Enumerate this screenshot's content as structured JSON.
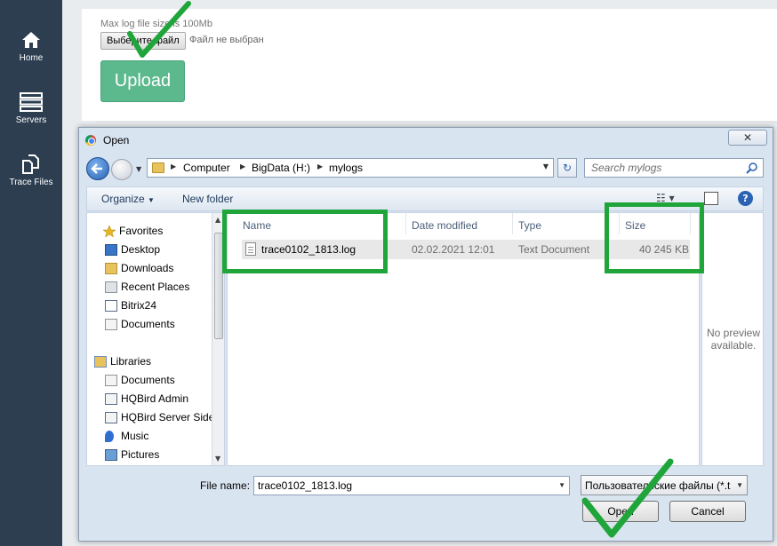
{
  "sidebar": {
    "items": [
      {
        "label": "Home",
        "icon": "home-icon"
      },
      {
        "label": "Servers",
        "icon": "servers-icon"
      },
      {
        "label": "Trace Files",
        "icon": "trace-files-icon"
      }
    ]
  },
  "upload": {
    "max_note": "Max log file size is 100Mb",
    "choose_file_label": "Выберите файл",
    "no_file_label": "Файл не выбран",
    "upload_label": "Upload"
  },
  "dialog": {
    "title": "Open",
    "close_label": "✕",
    "breadcrumb": [
      "Computer",
      "BigData (H:)",
      "mylogs"
    ],
    "search_placeholder": "Search mylogs",
    "toolbar": {
      "organize_label": "Organize",
      "new_folder_label": "New folder"
    },
    "nav": {
      "favorites_label": "Favorites",
      "favorites": [
        "Desktop",
        "Downloads",
        "Recent Places",
        "Bitrix24",
        "Documents"
      ],
      "libraries_label": "Libraries",
      "libraries": [
        "Documents",
        "HQBird Admin",
        "HQBird Server Side",
        "Music",
        "Pictures"
      ]
    },
    "columns": {
      "name": "Name",
      "date": "Date modified",
      "type": "Type",
      "size": "Size"
    },
    "files": [
      {
        "name": "trace0102_1813.log",
        "date": "02.02.2021 12:01",
        "type": "Text Document",
        "size": "40 245 KB"
      }
    ],
    "preview_text": "No preview available.",
    "filename_label": "File name:",
    "filename_value": "trace0102_1813.log",
    "filter_value": "Пользовательские файлы (*.t",
    "open_label": "Open",
    "cancel_label": "Cancel"
  },
  "colors": {
    "sidebar": "#2c3e50",
    "upload_button": "#5cb88d",
    "highlight": "#1fa53a"
  }
}
